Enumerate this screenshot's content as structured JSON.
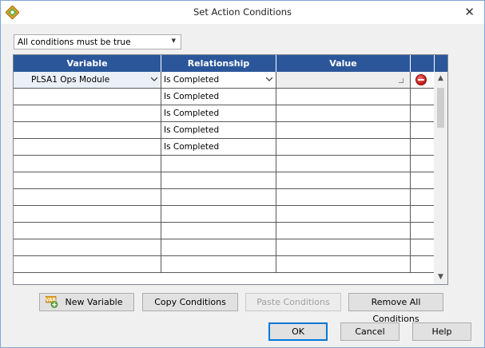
{
  "window": {
    "title": "Set Action Conditions",
    "close_glyph": "✕"
  },
  "match_mode": {
    "selected": "All conditions must be true"
  },
  "grid": {
    "columns": [
      "Variable",
      "Relationship",
      "Value",
      ""
    ],
    "rows": [
      {
        "variable": "PLSA1 Ops Module",
        "relationship": "Is Completed",
        "value": "",
        "selected": true
      },
      {
        "variable": "",
        "relationship": "Is Completed",
        "value": ""
      },
      {
        "variable": "",
        "relationship": "Is Completed",
        "value": ""
      },
      {
        "variable": "",
        "relationship": "Is Completed",
        "value": ""
      },
      {
        "variable": "",
        "relationship": "Is Completed",
        "value": ""
      },
      {
        "variable": "",
        "relationship": "",
        "value": ""
      },
      {
        "variable": "",
        "relationship": "",
        "value": ""
      },
      {
        "variable": "",
        "relationship": "",
        "value": ""
      },
      {
        "variable": "",
        "relationship": "",
        "value": ""
      },
      {
        "variable": "",
        "relationship": "",
        "value": ""
      },
      {
        "variable": "",
        "relationship": "",
        "value": ""
      },
      {
        "variable": "",
        "relationship": "",
        "value": ""
      }
    ]
  },
  "buttons": {
    "new_variable": "New Variable",
    "copy_conditions": "Copy Conditions",
    "paste_conditions": "Paste Conditions",
    "remove_all": "Remove All Conditions",
    "ok": "OK",
    "cancel": "Cancel",
    "help": "Help"
  },
  "colors": {
    "header": "#2b579a",
    "remove": "#c01818"
  }
}
